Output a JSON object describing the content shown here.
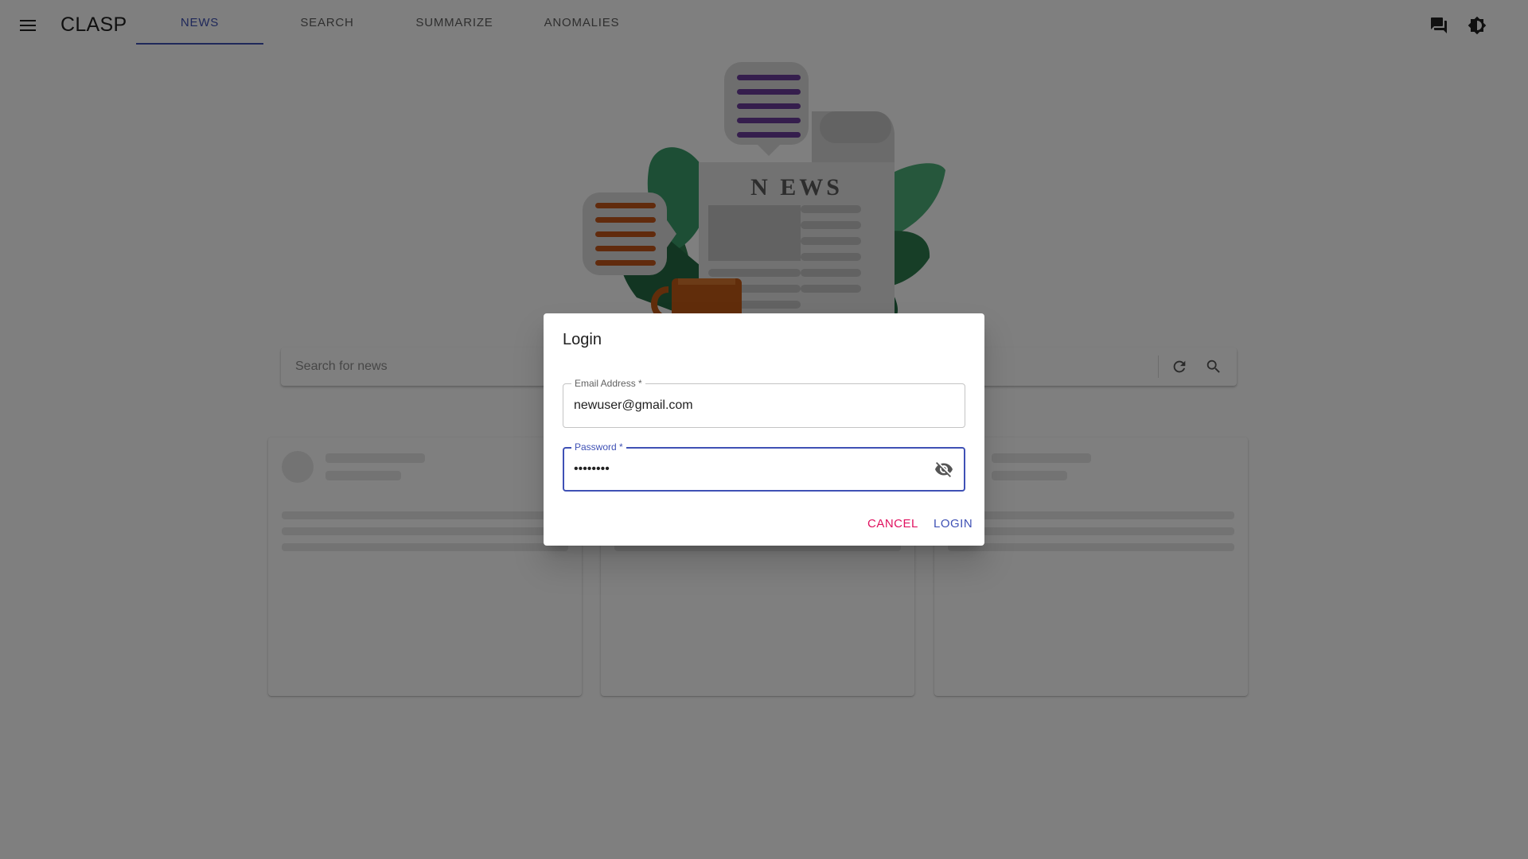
{
  "app": {
    "title": "CLASP"
  },
  "nav": {
    "tabs": [
      {
        "label": "NEWS",
        "active": true
      },
      {
        "label": "SEARCH",
        "active": false
      },
      {
        "label": "SUMMARIZE",
        "active": false
      },
      {
        "label": "ANOMALIES",
        "active": false
      }
    ],
    "icons": [
      "menu-icon",
      "chat-bubbles-icon",
      "brightness-icon"
    ]
  },
  "hero": {
    "headline": "N EWS"
  },
  "search": {
    "placeholder": "Search for news",
    "icons": [
      "refresh-icon",
      "search-icon"
    ]
  },
  "dialog": {
    "title": "Login",
    "email": {
      "label": "Email Address *",
      "value": "newuser@gmail.com"
    },
    "password": {
      "label": "Password *",
      "value": "••••••••",
      "toggle_icon": "visibility-off-icon"
    },
    "cancel_label": "CANCEL",
    "login_label": "LOGIN"
  },
  "colors": {
    "primary": "#3f51b5",
    "secondary": "#e0115f",
    "backdrop": "rgba(0,0,0,0.5)"
  }
}
